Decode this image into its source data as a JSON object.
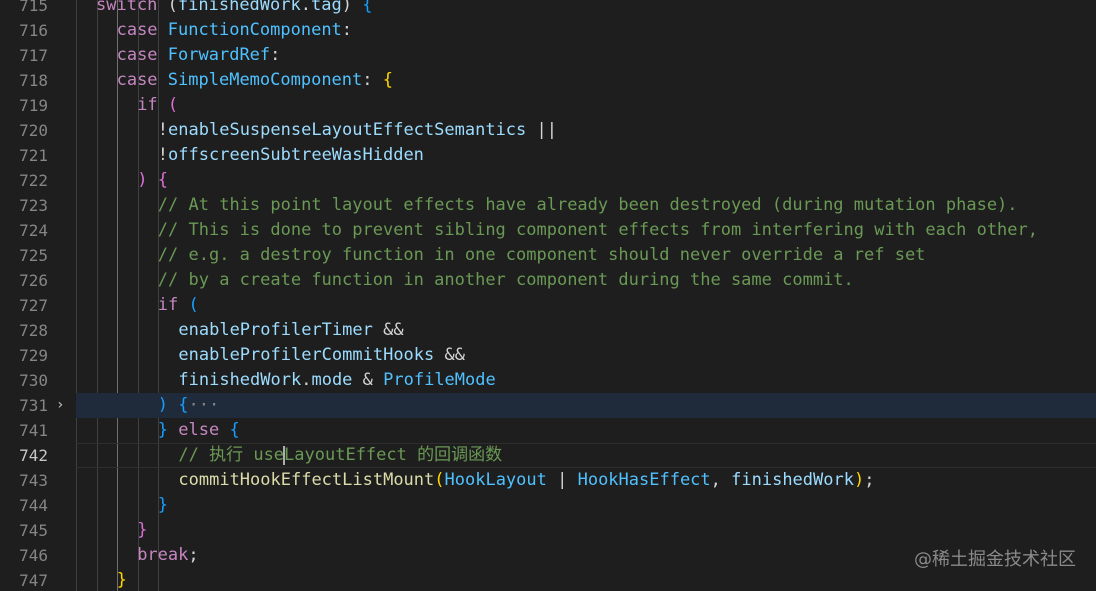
{
  "editor": {
    "current_line": "742",
    "highlighted_line": "731",
    "watermark": "@稀土掘金技术社区"
  },
  "lines": [
    {
      "num": "715",
      "tokens": [
        {
          "t": "switch",
          "c": "kw"
        },
        {
          "t": " (",
          "c": "pn"
        },
        {
          "t": "finishedWork",
          "c": "vr"
        },
        {
          "t": ".",
          "c": "pn"
        },
        {
          "t": "tag",
          "c": "vr"
        },
        {
          "t": ") ",
          "c": "pn"
        },
        {
          "t": "{",
          "c": "br3"
        }
      ]
    },
    {
      "num": "716",
      "tokens": [
        {
          "t": "case",
          "c": "kw"
        },
        {
          "t": " ",
          "c": "pn"
        },
        {
          "t": "FunctionComponent",
          "c": "cn"
        },
        {
          "t": ":",
          "c": "pn"
        }
      ]
    },
    {
      "num": "717",
      "tokens": [
        {
          "t": "case",
          "c": "kw"
        },
        {
          "t": " ",
          "c": "pn"
        },
        {
          "t": "ForwardRef",
          "c": "cn"
        },
        {
          "t": ":",
          "c": "pn"
        }
      ]
    },
    {
      "num": "718",
      "tokens": [
        {
          "t": "case",
          "c": "kw"
        },
        {
          "t": " ",
          "c": "pn"
        },
        {
          "t": "SimpleMemoComponent",
          "c": "cn"
        },
        {
          "t": ": ",
          "c": "pn"
        },
        {
          "t": "{",
          "c": "br1"
        }
      ]
    },
    {
      "num": "719",
      "tokens": [
        {
          "t": "if",
          "c": "kw"
        },
        {
          "t": " ",
          "c": "pn"
        },
        {
          "t": "(",
          "c": "br2"
        }
      ]
    },
    {
      "num": "720",
      "tokens": [
        {
          "t": "!",
          "c": "pn"
        },
        {
          "t": "enableSuspenseLayoutEffectSemantics",
          "c": "vr"
        },
        {
          "t": " ||",
          "c": "pn"
        }
      ]
    },
    {
      "num": "721",
      "tokens": [
        {
          "t": "!",
          "c": "pn"
        },
        {
          "t": "offscreenSubtreeWasHidden",
          "c": "vr"
        }
      ]
    },
    {
      "num": "722",
      "tokens": [
        {
          "t": ")",
          "c": "br2"
        },
        {
          "t": " ",
          "c": "pn"
        },
        {
          "t": "{",
          "c": "br2"
        }
      ]
    },
    {
      "num": "723",
      "tokens": [
        {
          "t": "// At this point layout effects have already been destroyed (during mutation phase).",
          "c": "cm"
        }
      ]
    },
    {
      "num": "724",
      "tokens": [
        {
          "t": "// This is done to prevent sibling component effects from interfering with each other,",
          "c": "cm"
        }
      ]
    },
    {
      "num": "725",
      "tokens": [
        {
          "t": "// e.g. a destroy function in one component should never override a ref set",
          "c": "cm"
        }
      ]
    },
    {
      "num": "726",
      "tokens": [
        {
          "t": "// by a create function in another component during the same commit.",
          "c": "cm"
        }
      ]
    },
    {
      "num": "727",
      "tokens": [
        {
          "t": "if",
          "c": "kw"
        },
        {
          "t": " ",
          "c": "pn"
        },
        {
          "t": "(",
          "c": "br3"
        }
      ]
    },
    {
      "num": "728",
      "tokens": [
        {
          "t": "enableProfilerTimer",
          "c": "vr"
        },
        {
          "t": " &&",
          "c": "pn"
        }
      ]
    },
    {
      "num": "729",
      "tokens": [
        {
          "t": "enableProfilerCommitHooks",
          "c": "vr"
        },
        {
          "t": " &&",
          "c": "pn"
        }
      ]
    },
    {
      "num": "730",
      "tokens": [
        {
          "t": "finishedWork",
          "c": "vr"
        },
        {
          "t": ".",
          "c": "pn"
        },
        {
          "t": "mode",
          "c": "vr"
        },
        {
          "t": " & ",
          "c": "pn"
        },
        {
          "t": "ProfileMode",
          "c": "cn"
        }
      ]
    },
    {
      "num": "731",
      "tokens": [
        {
          "t": ")",
          "c": "br3"
        },
        {
          "t": " ",
          "c": "pn"
        },
        {
          "t": "{",
          "c": "br3"
        },
        {
          "t": "···",
          "c": "fold-ellipsis"
        }
      ]
    },
    {
      "num": "741",
      "tokens": [
        {
          "t": "}",
          "c": "br3"
        },
        {
          "t": " ",
          "c": "pn"
        },
        {
          "t": "else",
          "c": "kw"
        },
        {
          "t": " ",
          "c": "pn"
        },
        {
          "t": "{",
          "c": "br3"
        }
      ]
    },
    {
      "num": "742",
      "tokens": [
        {
          "t": "// 执行 use",
          "c": "cm"
        },
        {
          "t": "",
          "c": "caret"
        },
        {
          "t": "LayoutEffect 的回调函数",
          "c": "cm"
        }
      ]
    },
    {
      "num": "743",
      "tokens": [
        {
          "t": "commitHookEffectListMount",
          "c": "fn"
        },
        {
          "t": "(",
          "c": "br1"
        },
        {
          "t": "HookLayout",
          "c": "cn"
        },
        {
          "t": " | ",
          "c": "pn"
        },
        {
          "t": "HookHasEffect",
          "c": "cn"
        },
        {
          "t": ", ",
          "c": "pn"
        },
        {
          "t": "finishedWork",
          "c": "vr"
        },
        {
          "t": ")",
          "c": "br1"
        },
        {
          "t": ";",
          "c": "pn"
        }
      ]
    },
    {
      "num": "744",
      "tokens": [
        {
          "t": "}",
          "c": "br3"
        }
      ]
    },
    {
      "num": "745",
      "tokens": [
        {
          "t": "}",
          "c": "br2"
        }
      ]
    },
    {
      "num": "746",
      "tokens": [
        {
          "t": "break",
          "c": "kw"
        },
        {
          "t": ";",
          "c": "pn"
        }
      ]
    },
    {
      "num": "747",
      "tokens": [
        {
          "t": "}",
          "c": "br1"
        }
      ]
    }
  ]
}
